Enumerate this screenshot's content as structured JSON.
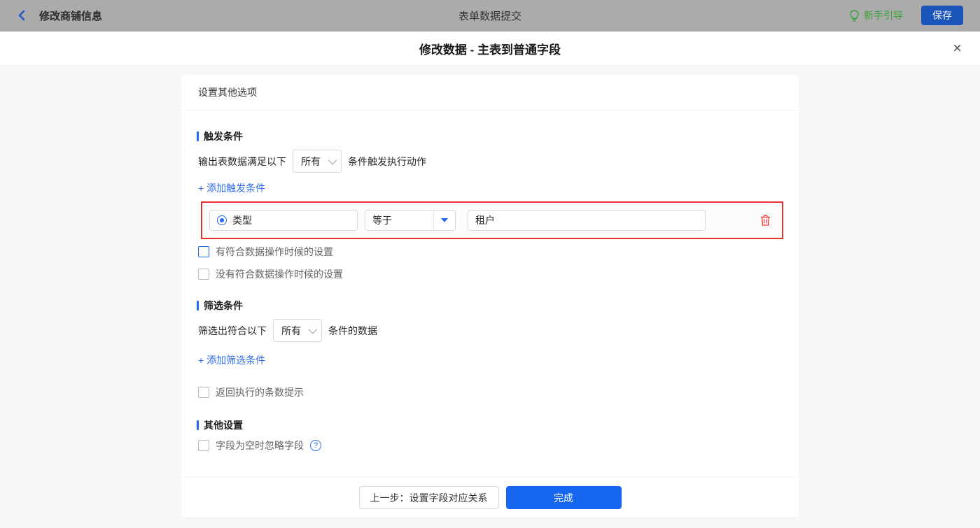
{
  "topbar": {
    "back_label": "修改商铺信息",
    "title": "表单数据提交",
    "guide_label": "新手引导",
    "save_label": "保存"
  },
  "dialog": {
    "title": "修改数据 - 主表到普通字段",
    "close_glyph": "×"
  },
  "card": {
    "header": "设置其他选项"
  },
  "trigger_section": {
    "title": "触发条件",
    "sentence_prefix": "输出表数据满足以下",
    "match_select_value": "所有",
    "sentence_suffix": "条件触发执行动作",
    "add_link": "+ 添加触发条件",
    "condition_row": {
      "field": "类型",
      "operator": "等于",
      "value": "租户"
    },
    "checkbox_match": "有符合数据操作时候的设置",
    "checkbox_no_match": "没有符合数据操作时候的设置"
  },
  "filter_section": {
    "title": "筛选条件",
    "sentence_prefix": "筛选出符合以下",
    "match_select_value": "所有",
    "sentence_suffix": "条件的数据",
    "add_link": "+ 添加筛选条件",
    "checkbox_count_hint": "返回执行的条数提示"
  },
  "other_section": {
    "title": "其他设置",
    "checkbox_ignore_empty": "字段为空时忽略字段",
    "help_glyph": "?"
  },
  "footer": {
    "prev_label": "上一步：设置字段对应关系",
    "done_label": "完成"
  },
  "colors": {
    "accent_blue": "#2468f2",
    "link_blue": "#2f6bf2",
    "primary_button": "#1766f0",
    "save_button": "#1c55ba",
    "guide_green": "#3aa33a",
    "highlight_red": "#e8312f",
    "topbar_dimmed": "#ababab"
  }
}
